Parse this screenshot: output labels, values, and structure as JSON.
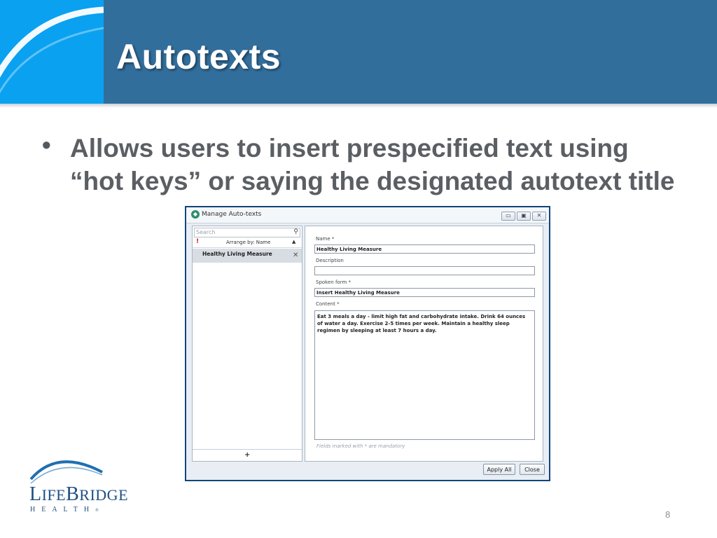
{
  "slide": {
    "title": "Autotexts",
    "bullet_text": "Allows users to insert prespecified text using “hot keys” or saying the designated autotext title",
    "page_number": "8"
  },
  "logo": {
    "name_big_l": "L",
    "name_ife": "IFE",
    "name_big_b": "B",
    "name_ridge": "RIDGE",
    "sub": "HEALTH",
    "registered": "®"
  },
  "dialog": {
    "title": "Manage Auto-texts",
    "icon": "app-icon",
    "window_buttons": [
      "minimize",
      "maximize",
      "close"
    ],
    "search_placeholder": "Search",
    "arrange_label": "Arrange by: Name",
    "arrange_alert": "!",
    "list_items": [
      "Healthy Living Measure"
    ],
    "add_label": "+",
    "fields": {
      "name_label": "Name *",
      "name_value": "Healthy Living Measure",
      "description_label": "Description",
      "description_value": "",
      "spoken_label": "Spoken form *",
      "spoken_value": "Insert Healthy Living Measure",
      "content_label": "Content *",
      "content_value": "Eat 3 meals a day - limit high fat and carbohydrate intake. Drink 64 ounces of water a day. Exercise 2-5 times per week. Maintain a healthy sleep regimen by sleeping at least 7 hours a day."
    },
    "mandatory_note": "Fields marked with * are mandatory",
    "apply_all_label": "Apply All",
    "close_label": "Close"
  },
  "colors": {
    "header_blue": "#326e9c",
    "header_light_blue": "#0aa1f0",
    "dialog_border": "#11457a",
    "logo_blue": "#1f4f82"
  }
}
